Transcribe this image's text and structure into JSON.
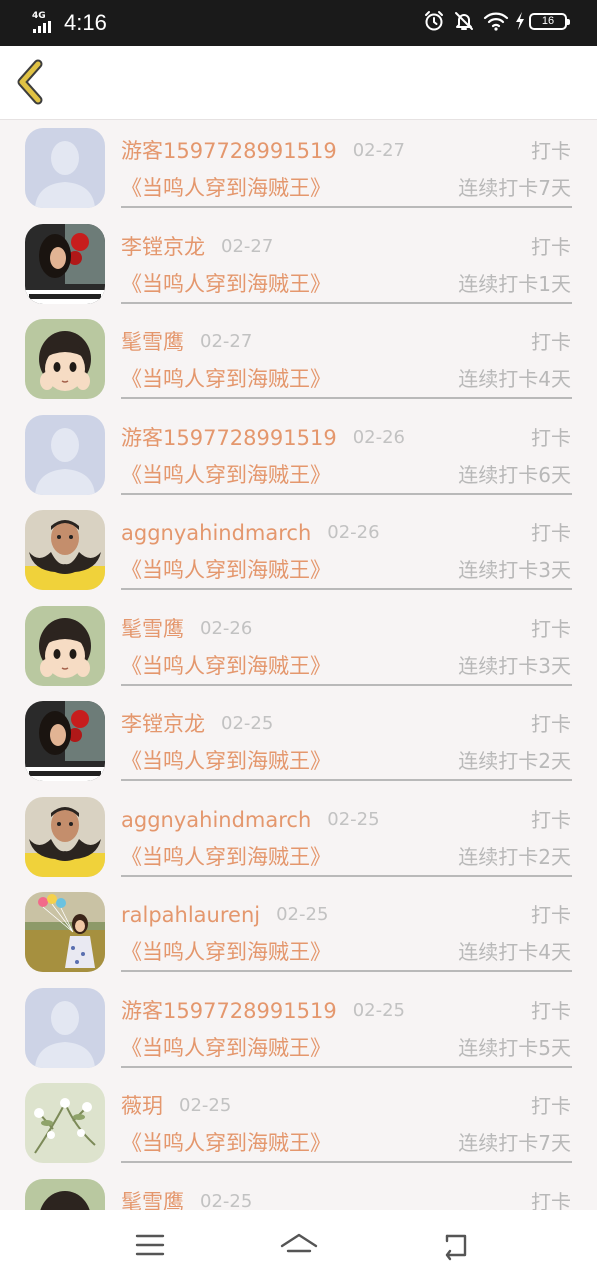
{
  "status_bar": {
    "network": "4G",
    "time": "4:16",
    "battery": "16",
    "icons": [
      "alarm-icon",
      "bell-muted-icon",
      "wifi-icon",
      "charging-icon",
      "battery-icon"
    ]
  },
  "header": {
    "back_icon": "chevron-left-icon",
    "accent_color": "#e0c244"
  },
  "colors": {
    "name": "#e4976d",
    "muted": "#c2c2c2",
    "action": "#b8b8b8"
  },
  "list": {
    "items": [
      {
        "avatar": "default-person-icon",
        "name": "游客1597728991519",
        "date": "02-27",
        "action": "打卡",
        "book": "《当鸣人穿到海贼王》",
        "streak": "连续打卡7天"
      },
      {
        "avatar": "photo-girl-red-icon",
        "name": "李镗京龙",
        "date": "02-27",
        "action": "打卡",
        "book": "《当鸣人穿到海贼王》",
        "streak": "连续打卡1天"
      },
      {
        "avatar": "anime-girl-icon",
        "name": "髦雪鹰",
        "date": "02-27",
        "action": "打卡",
        "book": "《当鸣人穿到海贼王》",
        "streak": "连续打卡4天"
      },
      {
        "avatar": "default-person-icon",
        "name": "游客1597728991519",
        "date": "02-26",
        "action": "打卡",
        "book": "《当鸣人穿到海贼王》",
        "streak": "连续打卡6天"
      },
      {
        "avatar": "bearded-man-icon",
        "name": "aggnyahindmarch",
        "date": "02-26",
        "action": "打卡",
        "book": "《当鸣人穿到海贼王》",
        "streak": "连续打卡3天"
      },
      {
        "avatar": "anime-girl-icon",
        "name": "髦雪鹰",
        "date": "02-26",
        "action": "打卡",
        "book": "《当鸣人穿到海贼王》",
        "streak": "连续打卡3天"
      },
      {
        "avatar": "photo-girl-red-icon",
        "name": "李镗京龙",
        "date": "02-25",
        "action": "打卡",
        "book": "《当鸣人穿到海贼王》",
        "streak": "连续打卡2天"
      },
      {
        "avatar": "bearded-man-icon",
        "name": "aggnyahindmarch",
        "date": "02-25",
        "action": "打卡",
        "book": "《当鸣人穿到海贼王》",
        "streak": "连续打卡2天"
      },
      {
        "avatar": "field-girl-balloons-icon",
        "name": "ralpahlaurenj",
        "date": "02-25",
        "action": "打卡",
        "book": "《当鸣人穿到海贼王》",
        "streak": "连续打卡4天"
      },
      {
        "avatar": "default-person-icon",
        "name": "游客1597728991519",
        "date": "02-25",
        "action": "打卡",
        "book": "《当鸣人穿到海贼王》",
        "streak": "连续打卡5天"
      },
      {
        "avatar": "flower-painting-icon",
        "name": "薇玥",
        "date": "02-25",
        "action": "打卡",
        "book": "《当鸣人穿到海贼王》",
        "streak": "连续打卡7天"
      },
      {
        "avatar": "anime-girl-icon",
        "name": "髦雪鹰",
        "date": "02-25",
        "action": "打卡",
        "book": "",
        "streak": ""
      }
    ]
  },
  "nav_bar": {
    "icons": [
      "menu-icon",
      "home-icon",
      "back-arrow-icon"
    ]
  }
}
